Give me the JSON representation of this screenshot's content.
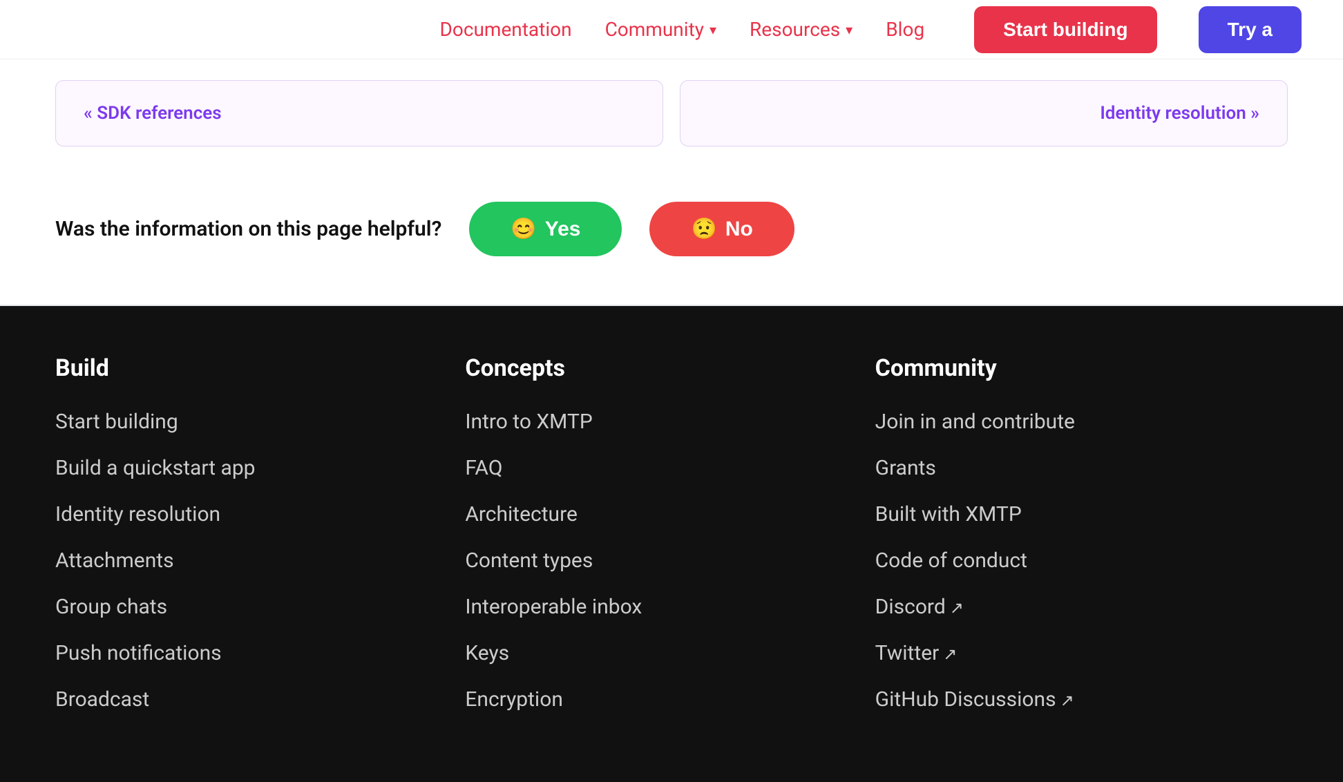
{
  "header": {
    "nav_links": [
      {
        "label": "Documentation",
        "has_dropdown": false,
        "key": "documentation"
      },
      {
        "label": "Community",
        "has_dropdown": true,
        "key": "community"
      },
      {
        "label": "Resources",
        "has_dropdown": true,
        "key": "resources"
      },
      {
        "label": "Blog",
        "has_dropdown": false,
        "key": "blog"
      }
    ],
    "btn_start_building": "Start building",
    "btn_try": "Try a"
  },
  "nav_cards": {
    "prev_label": "« SDK references",
    "next_label": "Identity resolution »"
  },
  "feedback": {
    "question": "Was the information on this page helpful?",
    "yes_label": "Yes",
    "no_label": "No",
    "yes_emoji": "😊",
    "no_emoji": "😟"
  },
  "footer": {
    "build": {
      "title": "Build",
      "links": [
        {
          "label": "Start building",
          "external": false
        },
        {
          "label": "Build a quickstart app",
          "external": false
        },
        {
          "label": "Identity resolution",
          "external": false
        },
        {
          "label": "Attachments",
          "external": false
        },
        {
          "label": "Group chats",
          "external": false
        },
        {
          "label": "Push notifications",
          "external": false
        },
        {
          "label": "Broadcast",
          "external": false
        }
      ]
    },
    "concepts": {
      "title": "Concepts",
      "links": [
        {
          "label": "Intro to XMTP",
          "external": false
        },
        {
          "label": "FAQ",
          "external": false
        },
        {
          "label": "Architecture",
          "external": false
        },
        {
          "label": "Content types",
          "external": false
        },
        {
          "label": "Interoperable inbox",
          "external": false
        },
        {
          "label": "Keys",
          "external": false
        },
        {
          "label": "Encryption",
          "external": false
        }
      ]
    },
    "community": {
      "title": "Community",
      "links": [
        {
          "label": "Join in and contribute",
          "external": false
        },
        {
          "label": "Grants",
          "external": false
        },
        {
          "label": "Built with XMTP",
          "external": false
        },
        {
          "label": "Code of conduct",
          "external": false
        },
        {
          "label": "Discord",
          "external": true
        },
        {
          "label": "Twitter",
          "external": true
        },
        {
          "label": "GitHub Discussions",
          "external": true
        }
      ]
    }
  }
}
